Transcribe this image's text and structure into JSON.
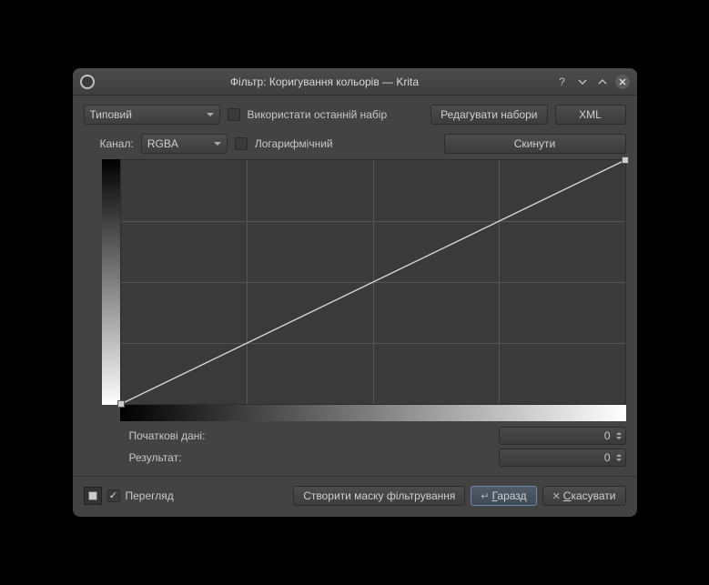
{
  "title": "Фільтр: Коригування кольорів — Krita",
  "toolbar": {
    "preset_value": "Типовий",
    "use_last_label": "Використати останній набір",
    "edit_presets_label": "Редагувати набори",
    "xml_label": "XML"
  },
  "channel": {
    "label": "Канал:",
    "value": "RGBA",
    "logarithmic_label": "Логарифмічний",
    "reset_label": "Скинути"
  },
  "io": {
    "input_label": "Початкові дані:",
    "output_label": "Результат:",
    "input_value": "0",
    "output_value": "0"
  },
  "footer": {
    "preview_label": "Перегляд",
    "create_mask_label": "Створити маску фільтрування",
    "ok_pre": "Г",
    "ok_rest": "аразд",
    "cancel_pre": "С",
    "cancel_rest": "касувати"
  }
}
